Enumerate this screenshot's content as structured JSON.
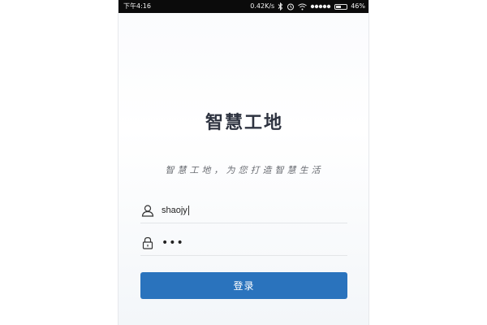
{
  "status_bar": {
    "time": "下午4:16",
    "speed": "0.42K/s",
    "battery": "46%",
    "battery_level": 0.46,
    "icons": [
      "bluetooth-icon",
      "alarm-icon",
      "wifi-icon",
      "signal-icon",
      "battery-icon"
    ]
  },
  "app": {
    "title": "智慧工地",
    "slogan": "智慧工地，为您打造智慧生活"
  },
  "form": {
    "username": "shaojy",
    "password_mask": "•••",
    "login_label": "登录"
  },
  "colors": {
    "primary": "#2a73bd",
    "title": "#2e3340",
    "status_bar": "#0b0b0b"
  }
}
